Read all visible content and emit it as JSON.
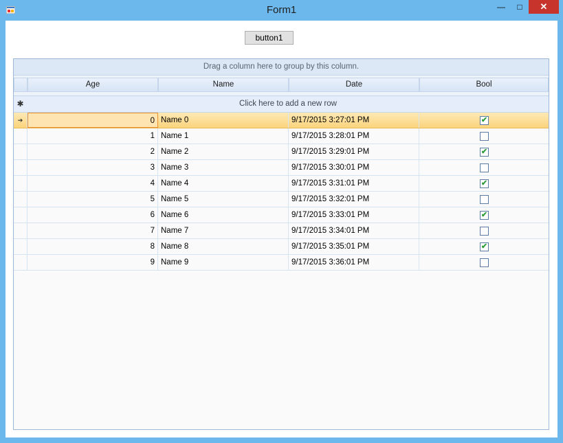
{
  "window": {
    "title": "Form1",
    "minimize_glyph": "—",
    "maximize_glyph": "□",
    "close_glyph": "✕",
    "icon": "app-icon"
  },
  "form": {
    "button_label": "button1"
  },
  "grid": {
    "group_panel_text": "Drag a column here to group by this column.",
    "columns": [
      "Age",
      "Name",
      "Date",
      "Bool"
    ],
    "new_row_glyph": "✱",
    "new_row_text": "Click here to add a new row",
    "current_row_glyph": "➔",
    "current_row_index": 0,
    "rows": [
      {
        "age": "0",
        "name": "Name 0",
        "date": "9/17/2015 3:27:01 PM",
        "bool": true
      },
      {
        "age": "1",
        "name": "Name 1",
        "date": "9/17/2015 3:28:01 PM",
        "bool": false
      },
      {
        "age": "2",
        "name": "Name 2",
        "date": "9/17/2015 3:29:01 PM",
        "bool": true
      },
      {
        "age": "3",
        "name": "Name 3",
        "date": "9/17/2015 3:30:01 PM",
        "bool": false
      },
      {
        "age": "4",
        "name": "Name 4",
        "date": "9/17/2015 3:31:01 PM",
        "bool": true
      },
      {
        "age": "5",
        "name": "Name 5",
        "date": "9/17/2015 3:32:01 PM",
        "bool": false
      },
      {
        "age": "6",
        "name": "Name 6",
        "date": "9/17/2015 3:33:01 PM",
        "bool": true
      },
      {
        "age": "7",
        "name": "Name 7",
        "date": "9/17/2015 3:34:01 PM",
        "bool": false
      },
      {
        "age": "8",
        "name": "Name 8",
        "date": "9/17/2015 3:35:01 PM",
        "bool": true
      },
      {
        "age": "9",
        "name": "Name 9",
        "date": "9/17/2015 3:36:01 PM",
        "bool": false
      }
    ],
    "check_glyph": "✔"
  },
  "colors": {
    "window_frame": "#6cb8ec",
    "close_button": "#c7342b",
    "current_row": "#fbd47c",
    "check": "#2f9c3a"
  }
}
